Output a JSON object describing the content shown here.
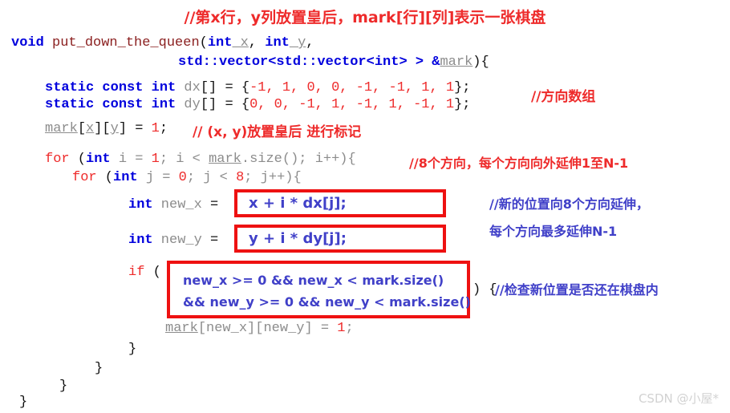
{
  "title_comment": "//第x行，y列放置皇后，mark[行][列]表示一张棋盘",
  "code": {
    "sig_line1": {
      "kw_void": "void",
      "fn_name": " put_down_the_queen",
      "paren_open": "(",
      "kw_int1": "int",
      "var_x": " x",
      "comma1": ", ",
      "kw_int2": "int",
      "var_y": " y",
      "comma2": ","
    },
    "sig_line2": {
      "vec": "std::vector<std::vector<int> > &",
      "mark": "mark",
      "tail": "){"
    },
    "dx_line": {
      "kw": "static const int",
      "name": " dx",
      "brackets": "[] = {",
      "values": "-1, 1, 0, 0, -1, -1, 1, 1",
      "close": "};"
    },
    "dy_line": {
      "kw": "static const int",
      "name": " dy",
      "brackets": "[] = {",
      "values": "0, 0, -1, 1, -1, 1, -1, 1",
      "close": "};"
    },
    "mark_assign": {
      "mark": "mark",
      "b1": "[",
      "x": "x",
      "b2": "][",
      "y": "y",
      "b3": "] = ",
      "one": "1",
      "semi": ";"
    },
    "for_i": {
      "ctl": "for",
      "open": " (",
      "kw": "int",
      "init": " i = ",
      "one": "1",
      "mid": "; i < ",
      "mark": "mark",
      "size": ".size(); i++){"
    },
    "for_j": {
      "ctl": "for",
      "open": " (",
      "kw": "int",
      "init": " j = ",
      "zero": "0",
      "mid": "; j < ",
      "eight": "8",
      "tail": "; j++){"
    },
    "new_x_decl": {
      "kw": "int",
      "name": " new_x",
      "eq": " = "
    },
    "new_y_decl": {
      "kw": "int",
      "name": " new_y",
      "eq": " = "
    },
    "if_open": {
      "ctl": "if",
      "paren": " ("
    },
    "if_close": ") {",
    "mark_set": {
      "mark": "mark",
      "b1": "[",
      "nx": "new_x",
      "b2": "][",
      "ny": "new_y",
      "b3": "] = ",
      "one": "1",
      "semi": ";"
    },
    "brace_1": "}",
    "brace_2": "}",
    "brace_3": "}",
    "brace_4": "}"
  },
  "boxes": {
    "new_x_expr": "x + i * dx[j];",
    "new_y_expr": "y + i * dy[j];",
    "if_cond_line1": "new_x >= 0 && new_x < mark.size()",
    "if_cond_line2": "&& new_y >= 0 && new_y < mark.size()"
  },
  "comments": {
    "direction_array": "//方向数组",
    "mark_queen": "// (x, y)放置皇后 进行标记",
    "eight_directions": "//8个方向，每个方向向外延伸1至N-1",
    "extend_line1": "//新的位置向8个方向延伸，",
    "extend_line2": "每个方向最多延伸N-1",
    "check_bounds": "//检查新位置是否还在棋盘内"
  },
  "watermark": "CSDN @小屋*",
  "colors": {
    "comment_red": "#ee2b2b",
    "comment_blue": "#4040c8",
    "keyword_blue": "#0000dd",
    "function_maroon": "#8b2020",
    "variable_gray": "#8c8c8c",
    "box_border": "#ee1111"
  }
}
